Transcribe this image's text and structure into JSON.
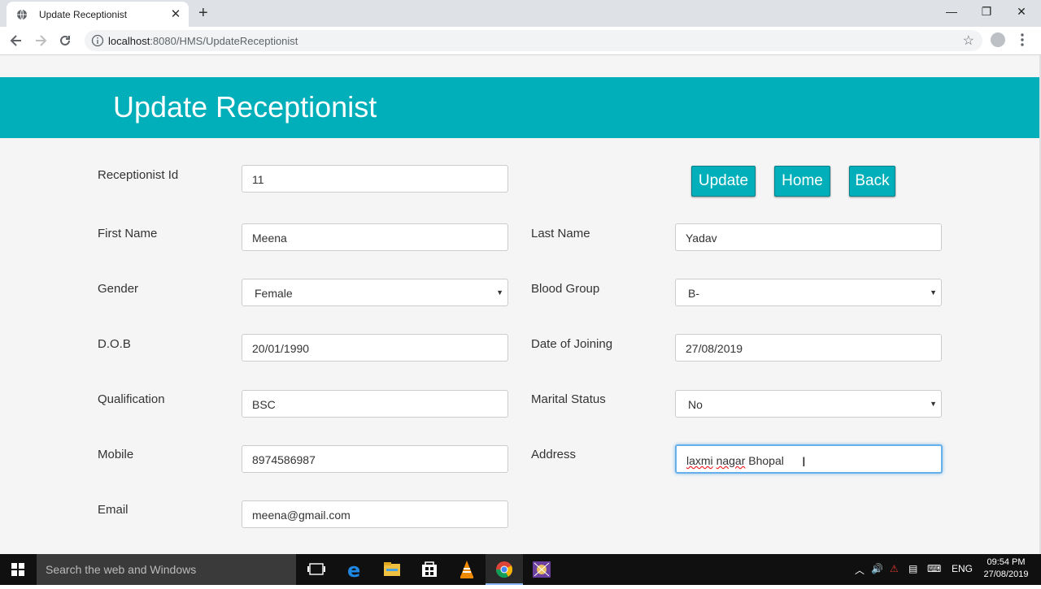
{
  "browser": {
    "tab_title": "Update Receptionist",
    "new_tab": "+",
    "url_host": "localhost",
    "url_path": ":8080/HMS/UpdateReceptionist"
  },
  "page": {
    "title": "Update Receptionist",
    "buttons": {
      "update": "Update",
      "home": "Home",
      "back": "Back"
    },
    "fields": {
      "receptionist_id": {
        "label": "Receptionist Id",
        "value": "11"
      },
      "first_name": {
        "label": "First Name",
        "value": "Meena"
      },
      "last_name": {
        "label": "Last Name",
        "value": "Yadav"
      },
      "gender": {
        "label": "Gender",
        "value": "Female"
      },
      "blood_group": {
        "label": "Blood Group",
        "value": "B-"
      },
      "dob": {
        "label": "D.O.B",
        "value": "20/01/1990"
      },
      "date_of_joining": {
        "label": "Date of Joining",
        "value": "27/08/2019"
      },
      "qualification": {
        "label": "Qualification",
        "value": "BSC"
      },
      "marital_status": {
        "label": "Marital Status",
        "value": "No"
      },
      "mobile": {
        "label": "Mobile",
        "value": "8974586987"
      },
      "address": {
        "label": "Address",
        "value_part1": "laxmi",
        "value_part2": "nagar",
        "value_part3": "Bhopal"
      },
      "email": {
        "label": "Email",
        "value": "meena@gmail.com"
      }
    }
  },
  "taskbar": {
    "search_placeholder": "Search the web and Windows",
    "language": "ENG",
    "time": "09:54 PM",
    "date": "27/08/2019"
  },
  "colors": {
    "accent": "#00afb9",
    "focus": "#66afe9"
  }
}
